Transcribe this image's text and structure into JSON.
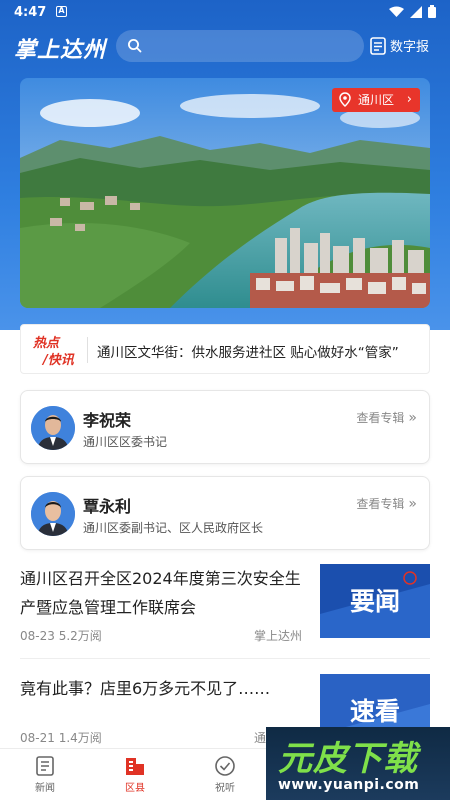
{
  "status_bar": {
    "time": "4:47",
    "notification_icon": "A"
  },
  "top_bar": {
    "logo": "掌上达州",
    "search_placeholder": "",
    "digital_newspaper_label": "数字报"
  },
  "banner": {
    "location_label": "通川区"
  },
  "hot_news": {
    "tag_line1": "热点",
    "tag_line2": "/快讯",
    "headline": "通川区文华街：供水服务进社区 贴心做好水“管家”"
  },
  "officials": [
    {
      "name": "李祝荣",
      "title": "通川区区委书记",
      "link_label": "查看专辑"
    },
    {
      "name": "覃永利",
      "title": "通川区委副书记、区人民政府区长",
      "link_label": "查看专辑"
    }
  ],
  "news": [
    {
      "title": "通川区召开全区2024年度第三次安全生产暨应急管理工作联席会",
      "date": "08-23",
      "views": "5.2万阅",
      "source": "掌上达州",
      "thumb_label": "要闻"
    },
    {
      "title": "竟有此事？店里6万多元不见了……",
      "date": "08-21",
      "views": "1.4万阅",
      "source": "通川",
      "thumb_label": "速看"
    }
  ],
  "tab_bar": [
    {
      "label": "新闻",
      "icon": "news-icon"
    },
    {
      "label": "区县",
      "icon": "district-icon"
    },
    {
      "label": "祝听",
      "icon": "check-icon"
    }
  ],
  "watermark": {
    "text": "元皮下载",
    "url": "www.yuanpi.com"
  },
  "colors": {
    "primary_blue": "#2f7fe0",
    "accent_red": "#e03325",
    "watermark_green": "#7fe04a"
  }
}
